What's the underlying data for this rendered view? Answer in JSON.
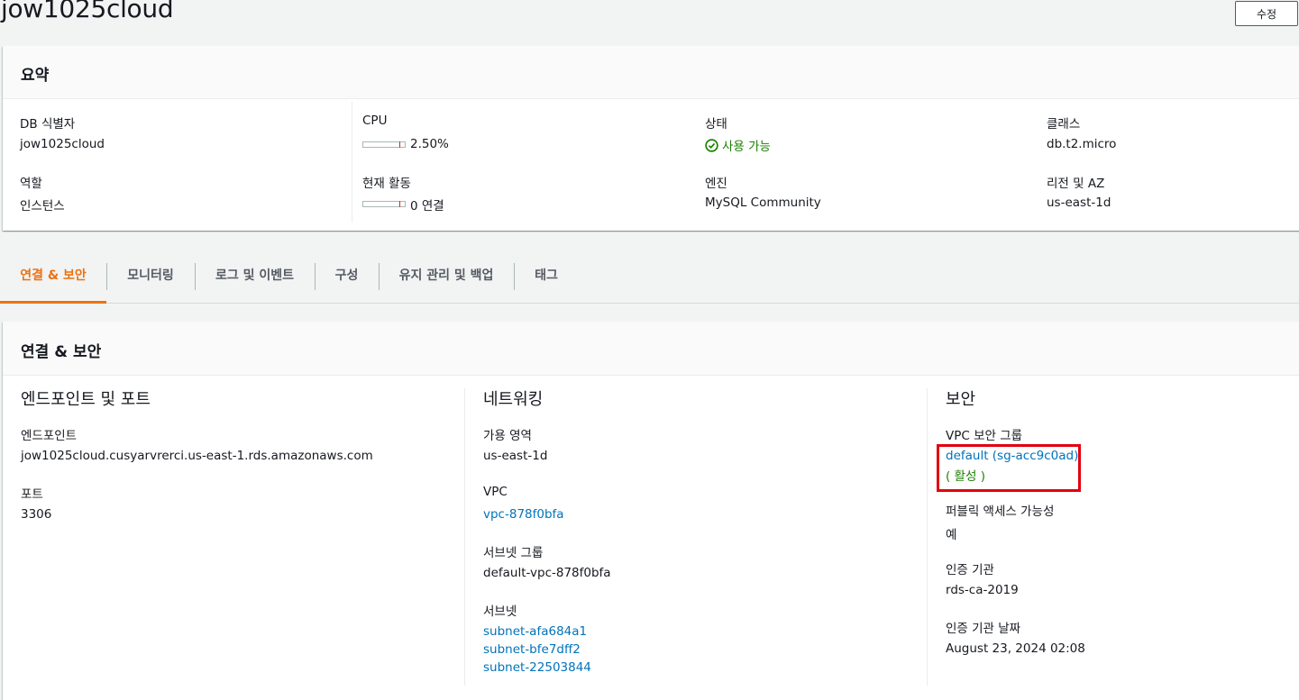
{
  "page": {
    "title": "jow1025cloud",
    "edit_label": "수정"
  },
  "summary": {
    "title": "요약",
    "db_id_label": "DB 식별자",
    "db_id_value": "jow1025cloud",
    "role_label": "역할",
    "role_value": "인스턴스",
    "cpu_label": "CPU",
    "cpu_value": "2.50%",
    "cpu_percent": 2.5,
    "activity_label": "현재 활동",
    "activity_value": "0 연결",
    "status_label": "상태",
    "status_value": "사용 가능",
    "engine_label": "엔진",
    "engine_value": "MySQL Community",
    "class_label": "클래스",
    "class_value": "db.t2.micro",
    "region_label": "리전 및 AZ",
    "region_value": "us-east-1d"
  },
  "tabs": [
    {
      "label": "연결 & 보안",
      "active": true
    },
    {
      "label": "모니터링",
      "active": false
    },
    {
      "label": "로그 및 이벤트",
      "active": false
    },
    {
      "label": "구성",
      "active": false
    },
    {
      "label": "유지 관리 및 백업",
      "active": false
    },
    {
      "label": "태그",
      "active": false
    }
  ],
  "connectivity": {
    "title": "연결 & 보안",
    "endpoint_section": {
      "title": "엔드포인트 및 포트",
      "endpoint_label": "엔드포인트",
      "endpoint_value": "jow1025cloud.cusyarvrerci.us-east-1.rds.amazonaws.com",
      "port_label": "포트",
      "port_value": "3306"
    },
    "networking": {
      "title": "네트워킹",
      "az_label": "가용 영역",
      "az_value": "us-east-1d",
      "vpc_label": "VPC",
      "vpc_value": "vpc-878f0bfa",
      "subnet_group_label": "서브넷 그룹",
      "subnet_group_value": "default-vpc-878f0bfa",
      "subnets_label": "서브넷",
      "subnets": [
        "subnet-afa684a1",
        "subnet-bfe7dff2",
        "subnet-22503844"
      ]
    },
    "security": {
      "title": "보안",
      "vpc_sg_label": "VPC 보안 그룹",
      "vpc_sg_value": "default (sg-acc9c0ad)",
      "vpc_sg_status": "( 활성 )",
      "public_label": "퍼블릭 액세스 가능성",
      "public_value": "예",
      "ca_label": "인증 기관",
      "ca_value": "rds-ca-2019",
      "ca_date_label": "인증 기관 날짜",
      "ca_date_value": "August 23, 2024 02:08"
    }
  },
  "colors": {
    "accent": "#ec7211",
    "link": "#0073bb",
    "success": "#1d8102",
    "highlight": "#e3000f"
  }
}
